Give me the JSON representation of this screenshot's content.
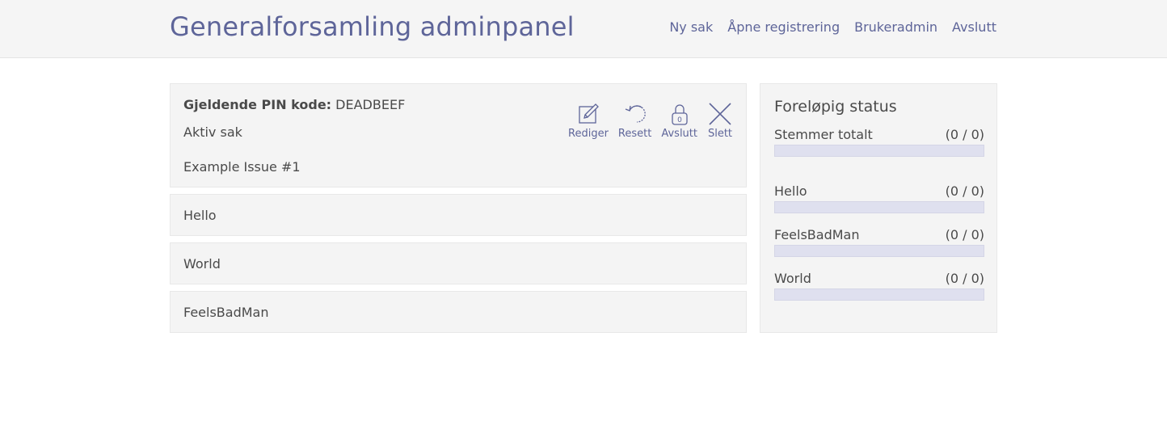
{
  "header": {
    "title": "Generalforsamling adminpanel",
    "nav": [
      "Ny sak",
      "Åpne registrering",
      "Brukeradmin",
      "Avslutt"
    ]
  },
  "issue": {
    "pin_label": "Gjeldende PIN kode:",
    "pin_value": "DEADBEEF",
    "active_label": "Aktiv sak",
    "title": "Example Issue #1",
    "actions": [
      {
        "label": "Rediger",
        "icon": "edit-icon"
      },
      {
        "label": "Resett",
        "icon": "reset-icon"
      },
      {
        "label": "Avslutt",
        "icon": "lock-icon",
        "badge": "0"
      },
      {
        "label": "Slett",
        "icon": "close-icon"
      }
    ],
    "alternatives": [
      "Hello",
      "World",
      "FeelsBadMan"
    ]
  },
  "status": {
    "title": "Foreløpig status",
    "rows": [
      {
        "label": "Stemmer totalt",
        "count": "(0 / 0)",
        "fraction": 0
      },
      {
        "label": "Hello",
        "count": "(0 / 0)",
        "fraction": 0
      },
      {
        "label": "FeelsBadMan",
        "count": "(0 / 0)",
        "fraction": 0
      },
      {
        "label": "World",
        "count": "(0 / 0)",
        "fraction": 0
      }
    ]
  },
  "colors": {
    "accent": "#5e6599",
    "bar_bg": "#dfe0ef",
    "panel_bg": "#f4f4f4"
  }
}
